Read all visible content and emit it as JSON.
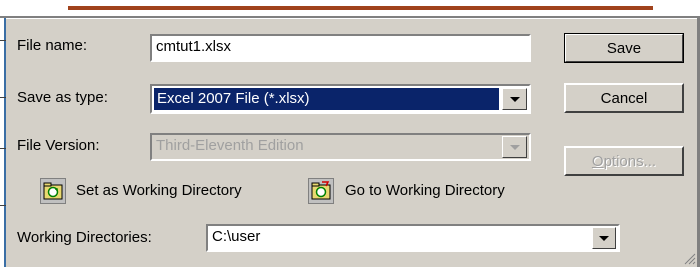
{
  "form": {
    "file_name_label": "File name:",
    "file_name_value": "cmtut1.xlsx",
    "save_as_type_label": "Save as type:",
    "save_as_type_value": "Excel 2007 File (*.xlsx)",
    "file_version_label": "File Version:",
    "file_version_value": "Third-Eleventh Edition",
    "working_directories_label": "Working Directories:",
    "working_directories_value": "C:\\user"
  },
  "buttons": {
    "save": "Save",
    "cancel": "Cancel",
    "options_mnemonic": "O",
    "options_rest": "ptions...",
    "set_working_directory": "Set as Working Directory",
    "go_to_working_directory": "Go to Working Directory"
  },
  "icons": {
    "set_dir": "folder-refresh-icon",
    "go_dir": "folder-go-icon",
    "dropdown": "chevron-down-icon"
  },
  "colors": {
    "dialog_bg": "#d4d0c8",
    "selection_bg": "#0a246a",
    "title_accent": "#a0421c"
  }
}
